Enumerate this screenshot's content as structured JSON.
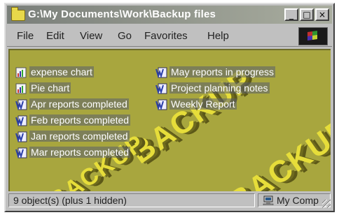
{
  "window": {
    "title": "G:\\My Documents\\Work\\Backup files",
    "minimize_label": "_",
    "maximize_label": "□",
    "close_label": "×"
  },
  "menu": [
    "File",
    "Edit",
    "View",
    "Go",
    "Favorites",
    "Help"
  ],
  "watermark": "BACKUP",
  "files": [
    {
      "name": "expense chart",
      "icon": "chart-document-icon"
    },
    {
      "name": "Pie chart",
      "icon": "chart-document-icon"
    },
    {
      "name": "Apr reports completed",
      "icon": "word-document-icon"
    },
    {
      "name": "Feb reports completed",
      "icon": "word-document-icon"
    },
    {
      "name": "Jan reports completed",
      "icon": "word-document-icon"
    },
    {
      "name": "Mar reports completed",
      "icon": "word-document-icon"
    },
    {
      "name": "May reports in progress",
      "icon": "word-document-icon"
    },
    {
      "name": "Project planning notes",
      "icon": "word-document-icon"
    },
    {
      "name": "Weekly Report",
      "icon": "word-document-icon"
    }
  ],
  "status": {
    "objects": "9 object(s) (plus 1 hidden)",
    "location": "My Comp"
  },
  "colors": {
    "desktop_bg": "#a8a63e",
    "watermark": "#e6dd3a",
    "chrome": "#c0c0c0"
  }
}
